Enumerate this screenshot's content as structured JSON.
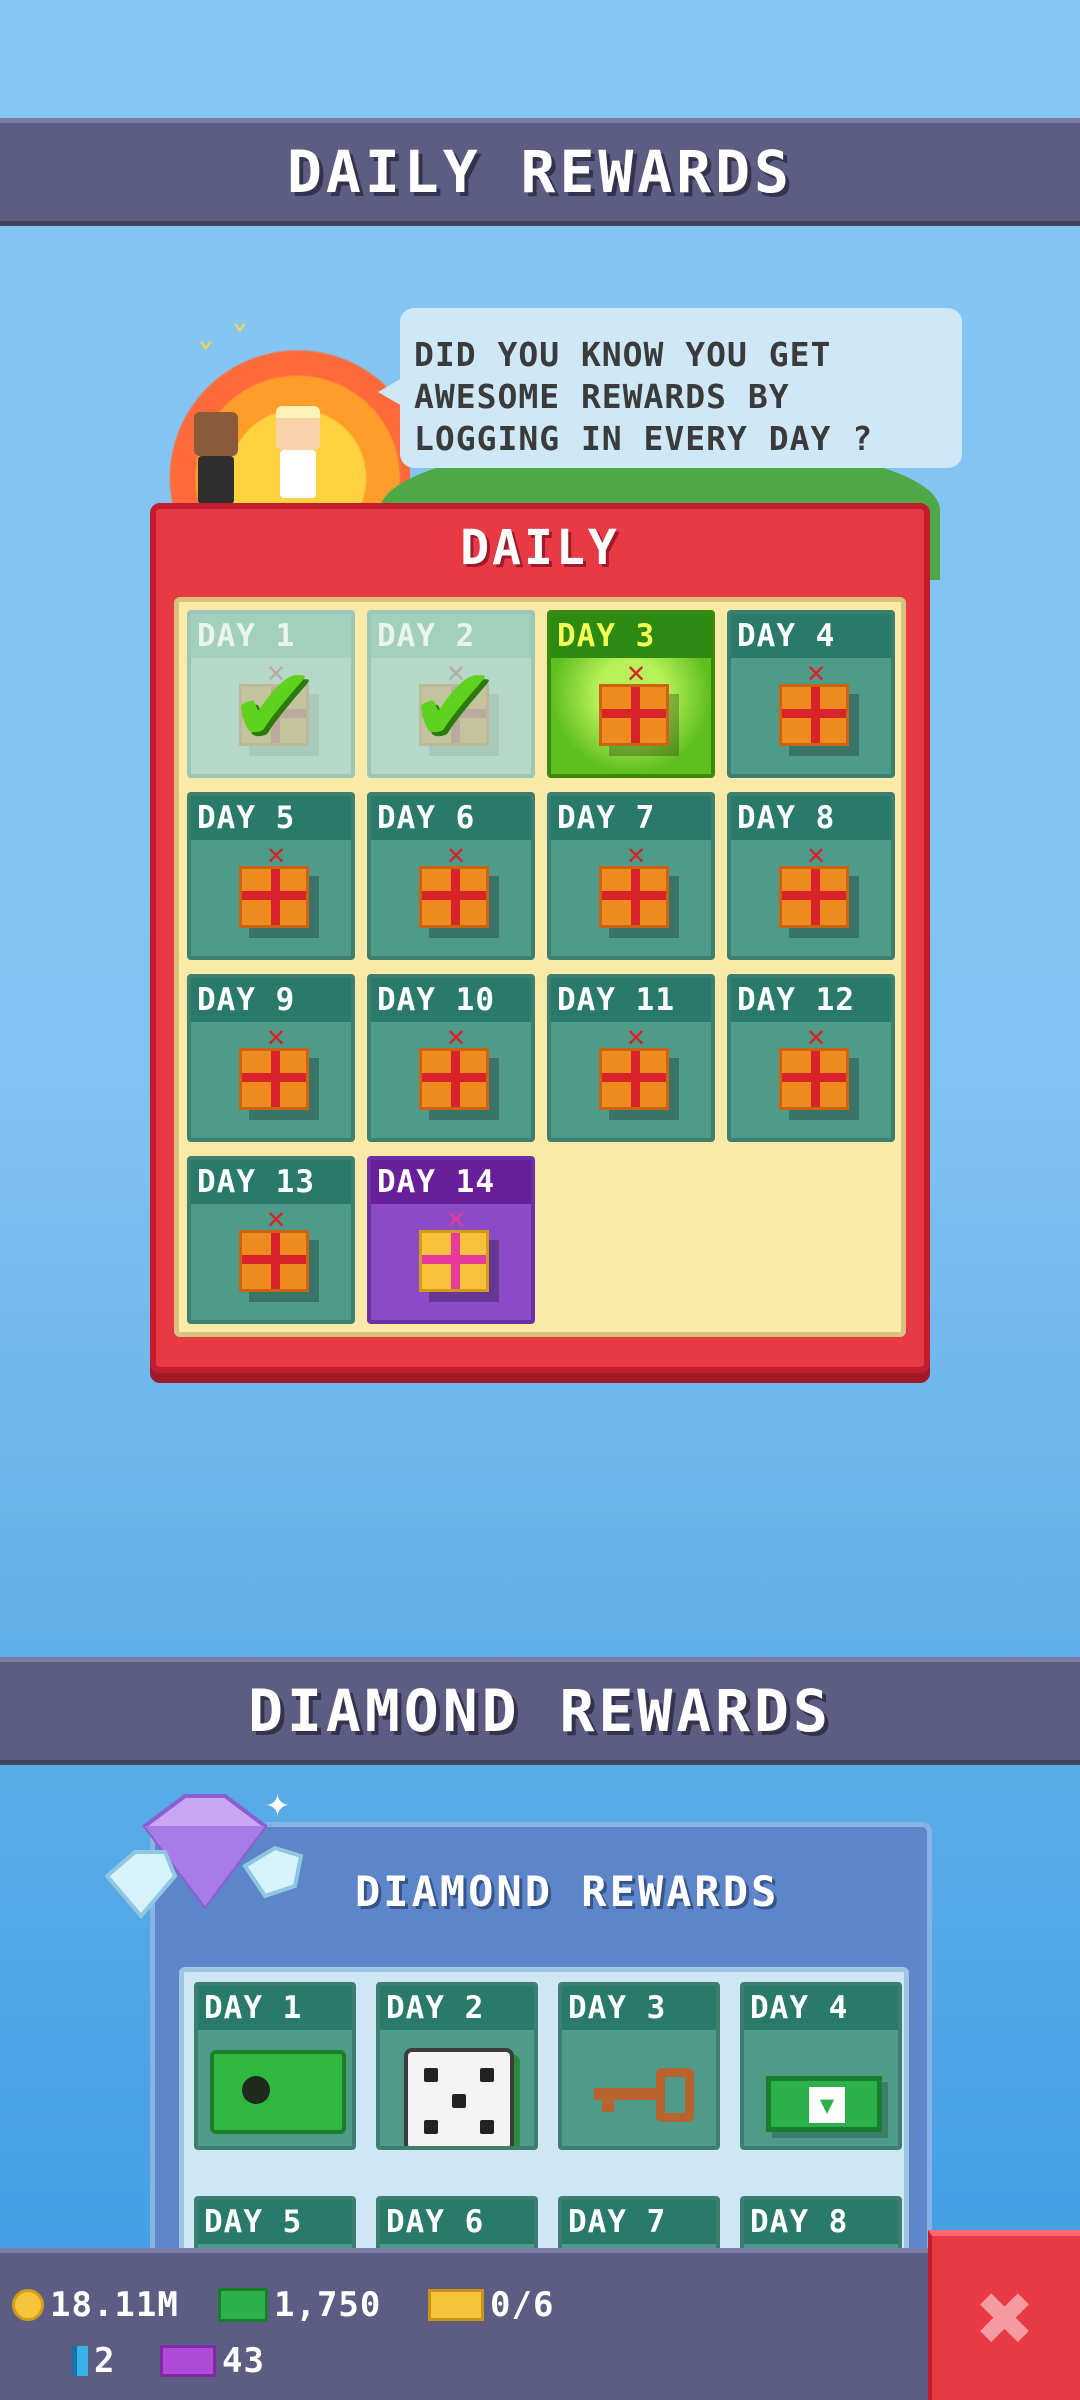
{
  "daily_banner": {
    "title": "DAILY REWARDS"
  },
  "speech": {
    "line1": "DID YOU KNOW YOU GET",
    "line2": "AWESOME REWARDS BY",
    "line3": "LOGGING IN EVERY DAY ?"
  },
  "daily_panel": {
    "title": "DAILY",
    "days": [
      {
        "label": "DAY 1",
        "state": "claimed"
      },
      {
        "label": "DAY 2",
        "state": "claimed"
      },
      {
        "label": "DAY 3",
        "state": "today"
      },
      {
        "label": "DAY 4",
        "state": "locked"
      },
      {
        "label": "DAY 5",
        "state": "locked"
      },
      {
        "label": "DAY 6",
        "state": "locked"
      },
      {
        "label": "DAY 7",
        "state": "locked"
      },
      {
        "label": "DAY 8",
        "state": "locked"
      },
      {
        "label": "DAY 9",
        "state": "locked"
      },
      {
        "label": "DAY 10",
        "state": "locked"
      },
      {
        "label": "DAY 11",
        "state": "locked"
      },
      {
        "label": "DAY 12",
        "state": "locked"
      },
      {
        "label": "DAY 13",
        "state": "locked"
      },
      {
        "label": "DAY 14",
        "state": "special"
      }
    ]
  },
  "diamond_banner": {
    "title": "DIAMOND REWARDS"
  },
  "diamond_panel": {
    "title": "DIAMOND REWARDS",
    "days": [
      {
        "label": "DAY 1",
        "reward": "chest-icon"
      },
      {
        "label": "DAY 2",
        "reward": "dice-icon"
      },
      {
        "label": "DAY 3",
        "reward": "key-icon"
      },
      {
        "label": "DAY 4",
        "reward": "cash-icon"
      },
      {
        "label": "DAY 5",
        "reward": ""
      },
      {
        "label": "DAY 6",
        "reward": ""
      },
      {
        "label": "DAY 7",
        "reward": ""
      },
      {
        "label": "DAY 8",
        "reward": ""
      }
    ]
  },
  "resources": {
    "coins": "18.11M",
    "cash": "1,750",
    "tickets": "0/6",
    "gems": "2",
    "vip": "43"
  },
  "colors": {
    "banner": "#5d5d83",
    "daily_panel": "#e83a45",
    "diamond_panel": "#5c86c9",
    "close_button": "#e83a45"
  }
}
